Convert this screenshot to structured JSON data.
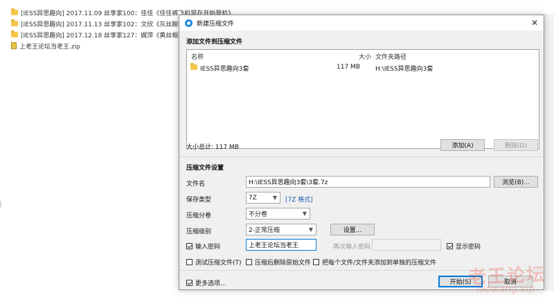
{
  "background_files": [
    {
      "type": "folder",
      "name": "[IESS异思趣向] 2017.11.09 丝享家100：佳佳《佳佳裤飞机现在开始登机》"
    },
    {
      "type": "folder",
      "name": "[IESS异思趣向] 2017.11.13 丝享家102：文欣《灰丝脚玩橘子》"
    },
    {
      "type": "folder",
      "name": "[IESS异思趣向] 2017.12.18 丝享家127：娓萍《黄丝帽肉丝红鞋"
    },
    {
      "type": "zip",
      "name": "上老王论坛当老王.zip"
    }
  ],
  "dialog": {
    "title": "新建压缩文件",
    "close": "✕",
    "add_section": "添加文件到压缩文件",
    "columns": {
      "name": "名称",
      "size": "大小",
      "path": "文件夹路径"
    },
    "rows": [
      {
        "name": "IESS异思趣向3套",
        "size": "117 MB",
        "path": "H:\\IESS异思趣向3套"
      }
    ],
    "total_label": "大小总计: 117 MB",
    "add_button": "添加(A)",
    "delete_button": "删除(D)",
    "settings_section": "压缩文件设置",
    "filename_label": "文件名",
    "filename_value": "H:\\IESS异思趣向3套\\3套.7z",
    "browse_button": "浏览(B)...",
    "save_type_label": "保存类型",
    "save_type_value": "7Z",
    "format_link": "[7Z 格式]",
    "split_label": "压缩分卷",
    "split_value": "不分卷",
    "level_label": "压缩级别",
    "level_value": "2-正常压缩",
    "settings_button": "设置...",
    "password_label": "输入密码",
    "password_value": "上老王论坛当老王",
    "reenter_label": "再次输入密码",
    "show_password_label": "显示密码",
    "test_label": "测试压缩文件(T)",
    "delete_after_label": "压缩后删除原始文件",
    "each_file_label": "把每个文件/文件夹添加到单独的压缩文件",
    "more_options_label": "更多选项...",
    "start_button": "开始(S)",
    "cancel_button": "取消"
  },
  "watermark": {
    "text": "老王论坛",
    "sub": "laowang.vip"
  }
}
